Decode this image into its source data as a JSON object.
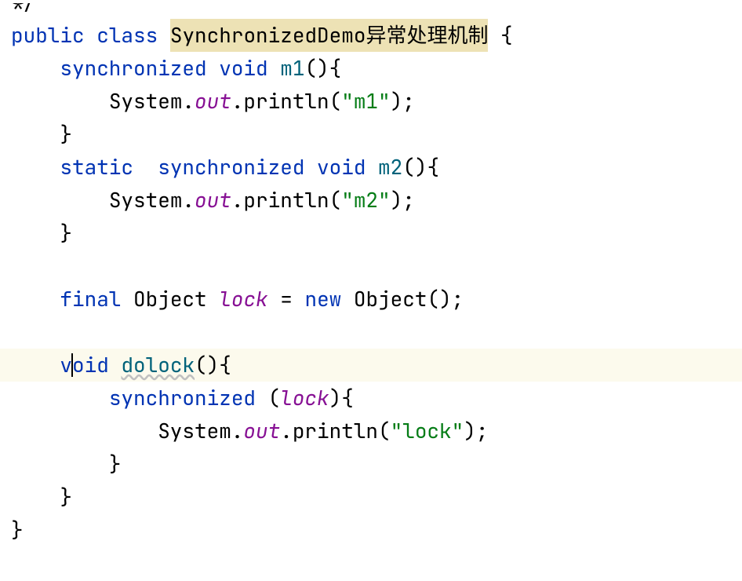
{
  "code": {
    "line0_comment_end": "*/",
    "line1": {
      "kw_public": "public",
      "kw_class": "class",
      "classname": "SynchronizedDemo异常处理机制",
      "brace": " {"
    },
    "line2": {
      "kw_sync": "synchronized",
      "kw_void": "void",
      "method": "m1",
      "parens": "(){"
    },
    "line3": {
      "system": "System.",
      "out": "out",
      "println": ".println(",
      "str": "\"m1\"",
      "end": ");"
    },
    "line4": {
      "brace": "}"
    },
    "line5": {
      "kw_static": "static",
      "kw_sync": "synchronized",
      "kw_void": "void",
      "method": "m2",
      "parens": "(){"
    },
    "line6": {
      "system": "System.",
      "out": "out",
      "println": ".println(",
      "str": "\"m2\"",
      "end": ");"
    },
    "line7": {
      "brace": "}"
    },
    "line8": {
      "kw_final": "final",
      "type": "Object",
      "field": "lock",
      "eq": " = ",
      "kw_new": "new",
      "ctor": " Object();"
    },
    "line9": {
      "v": "v",
      "oid": "oid",
      "method": "dolock",
      "parens": "(){"
    },
    "line10": {
      "kw_sync": "synchronized",
      "open": " (",
      "field": "lock",
      "close": "){"
    },
    "line11": {
      "system": "System.",
      "out": "out",
      "println": ".println(",
      "str": "\"lock\"",
      "end": ");"
    },
    "line12": {
      "brace": "}"
    },
    "line13": {
      "brace": "}"
    },
    "line14": {
      "brace": "}"
    }
  }
}
